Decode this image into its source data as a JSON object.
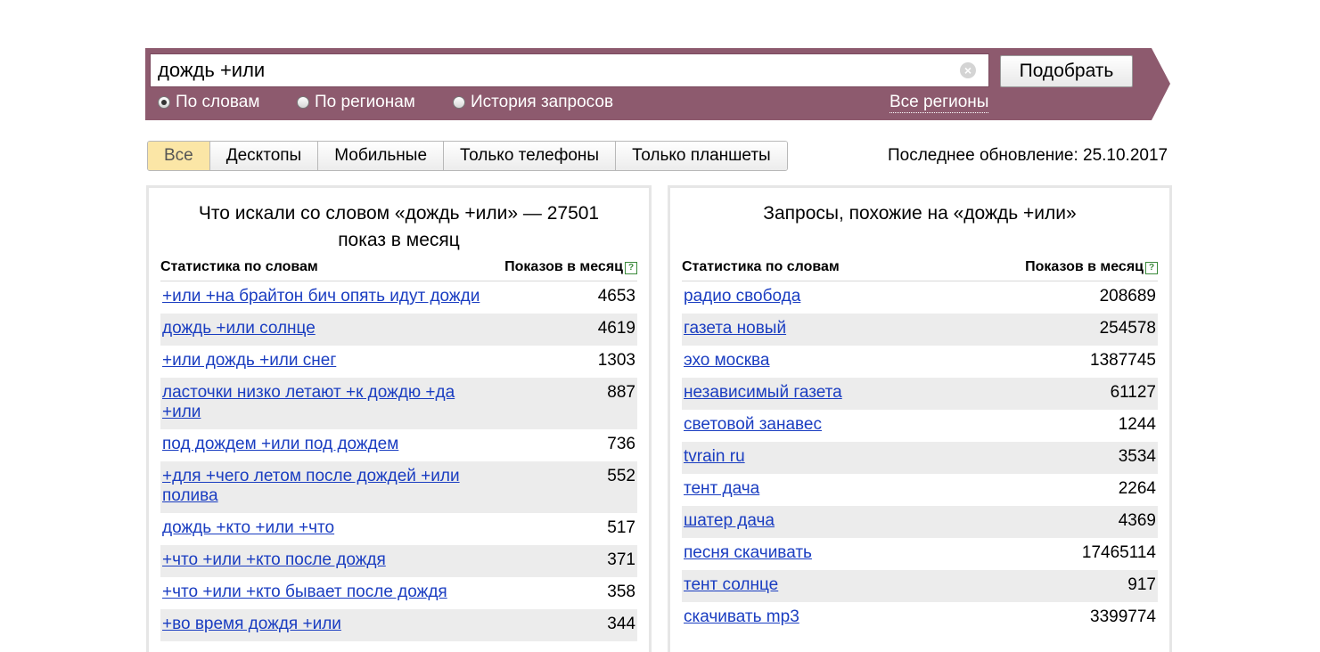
{
  "search": {
    "query": "дождь +или",
    "button_label": "Подобрать",
    "radios": [
      {
        "label": "По словам",
        "checked": true
      },
      {
        "label": "По регионам",
        "checked": false
      },
      {
        "label": "История запросов",
        "checked": false
      }
    ],
    "regions_link": "Все регионы"
  },
  "device_tabs": [
    "Все",
    "Десктопы",
    "Мобильные",
    "Только телефоны",
    "Только планшеты"
  ],
  "active_tab": "Все",
  "last_update": "Последнее обновление: 25.10.2017",
  "left_panel": {
    "title": "Что искали со словом «дождь +или» — 27501 показ в месяц",
    "col_phrase": "Статистика по словам",
    "col_count": "Показов в месяц",
    "rows": [
      {
        "phrase": "+или +на брайтон бич опять идут дожди",
        "count": "4653"
      },
      {
        "phrase": "дождь +или солнце",
        "count": "4619"
      },
      {
        "phrase": "+или дождь +или снег",
        "count": "1303"
      },
      {
        "phrase": "ласточки низко летают +к дождю +да +или",
        "count": "887"
      },
      {
        "phrase": "под дождем +или под дождем",
        "count": "736"
      },
      {
        "phrase": "+для +чего летом после дождей +или полива",
        "count": "552"
      },
      {
        "phrase": "дождь +кто +или +что",
        "count": "517"
      },
      {
        "phrase": "+что +или +кто после дождя",
        "count": "371"
      },
      {
        "phrase": "+что +или +кто бывает после дождя",
        "count": "358"
      },
      {
        "phrase": "+во время дождя +или",
        "count": "344"
      }
    ]
  },
  "right_panel": {
    "title": "Запросы, похожие на «дождь +или»",
    "col_phrase": "Статистика по словам",
    "col_count": "Показов в месяц",
    "rows": [
      {
        "phrase": "радио свобода",
        "count": "208689"
      },
      {
        "phrase": "газета новый",
        "count": "254578"
      },
      {
        "phrase": "эхо москва",
        "count": "1387745"
      },
      {
        "phrase": "независимый газета",
        "count": "61127"
      },
      {
        "phrase": "световой занавес",
        "count": "1244"
      },
      {
        "phrase": "tvrain ru",
        "count": "3534"
      },
      {
        "phrase": "тент дача",
        "count": "2264"
      },
      {
        "phrase": "шатер дача",
        "count": "4369"
      },
      {
        "phrase": "песня скачивать",
        "count": "17465114"
      },
      {
        "phrase": "тент солнце",
        "count": "917"
      },
      {
        "phrase": "скачивать mp3",
        "count": "3399774"
      }
    ]
  }
}
